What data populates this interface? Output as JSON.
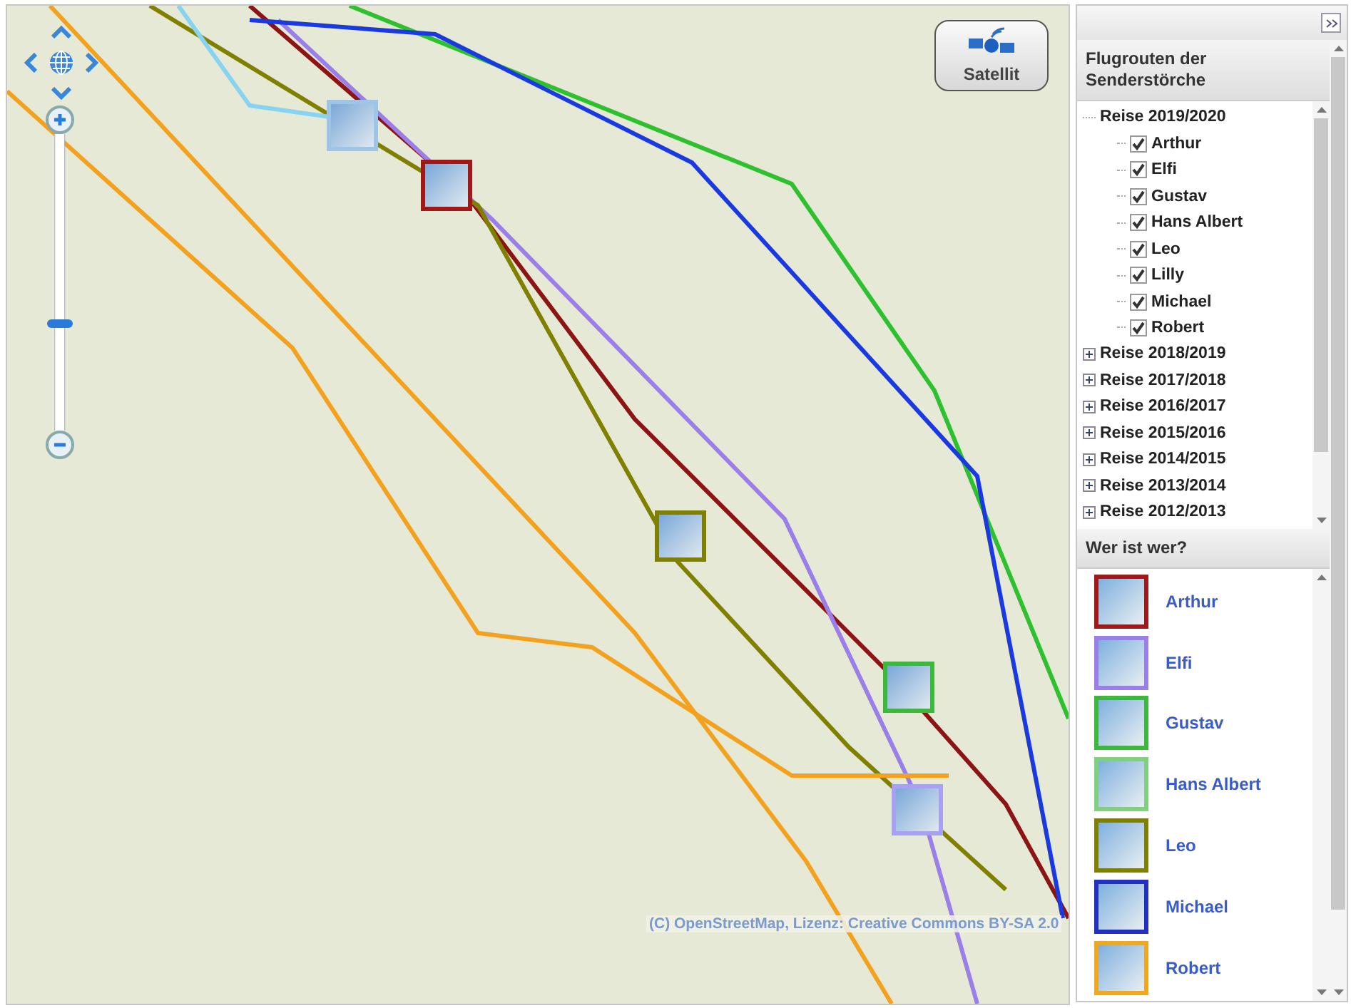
{
  "map": {
    "satellite_button": "Satellit",
    "zoom": {
      "level": 0.36
    },
    "attribution": "(C) OpenStreetMap, Lizenz: Creative Commons BY-SA 2.0",
    "markers": [
      {
        "color": "#9ec4e6"
      },
      {
        "color": "#a01818"
      },
      {
        "color": "#808000"
      },
      {
        "color": "#3cb83c"
      },
      {
        "color": "#a8a0f0"
      }
    ]
  },
  "sidebar": {
    "tree": {
      "title": "Flugrouten der Senderstörche",
      "items": [
        {
          "label": "Reise 2019/2020",
          "expanded": true,
          "children": [
            {
              "label": "Arthur",
              "checked": true
            },
            {
              "label": "Elfi",
              "checked": true
            },
            {
              "label": "Gustav",
              "checked": true
            },
            {
              "label": "Hans Albert",
              "checked": true
            },
            {
              "label": "Leo",
              "checked": true
            },
            {
              "label": "Lilly",
              "checked": true
            },
            {
              "label": "Michael",
              "checked": true
            },
            {
              "label": "Robert",
              "checked": true
            }
          ]
        },
        {
          "label": "Reise 2018/2019",
          "expanded": false
        },
        {
          "label": "Reise 2017/2018",
          "expanded": false
        },
        {
          "label": "Reise 2016/2017",
          "expanded": false
        },
        {
          "label": "Reise 2015/2016",
          "expanded": false
        },
        {
          "label": "Reise 2014/2015",
          "expanded": false
        },
        {
          "label": "Reise 2013/2014",
          "expanded": false
        },
        {
          "label": "Reise 2012/2013",
          "expanded": false
        }
      ]
    },
    "legend": {
      "title": "Wer ist wer?",
      "birds": [
        {
          "name": "Arthur",
          "color": "#a01818"
        },
        {
          "name": "Elfi",
          "color": "#9b7fe8"
        },
        {
          "name": "Gustav",
          "color": "#3cb83c"
        },
        {
          "name": "Hans Albert",
          "color": "#80d080"
        },
        {
          "name": "Leo",
          "color": "#808000"
        },
        {
          "name": "Michael",
          "color": "#2030c0"
        },
        {
          "name": "Robert",
          "color": "#f0a820"
        }
      ]
    }
  }
}
